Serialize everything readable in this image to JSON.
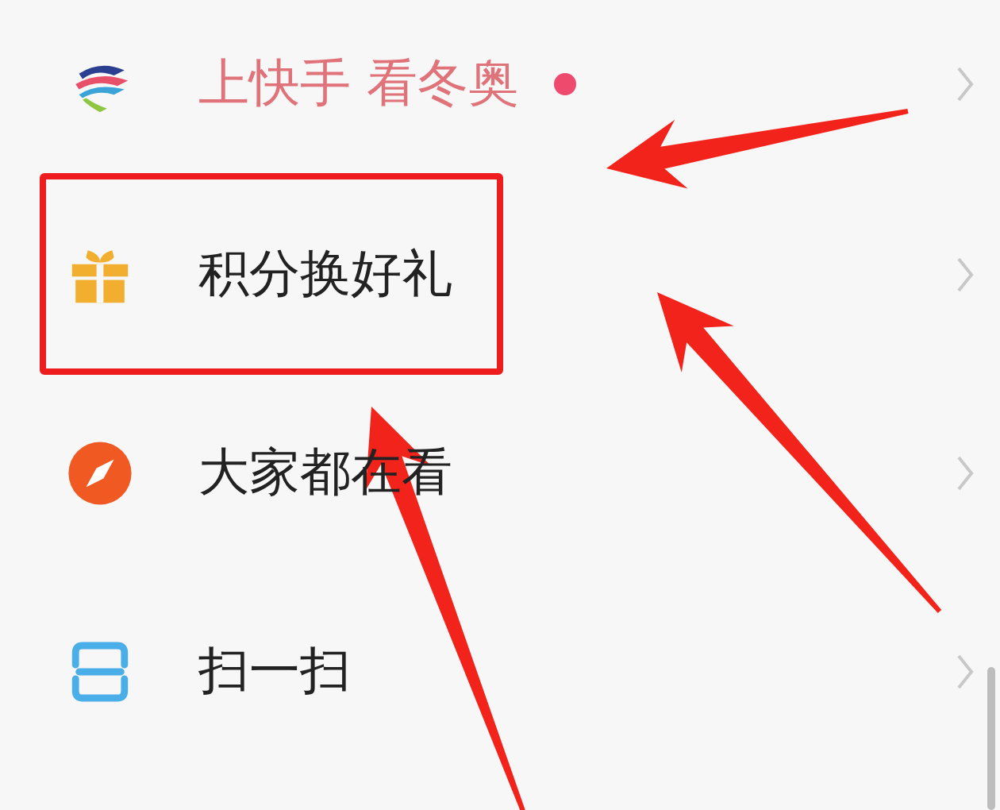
{
  "menu": {
    "items": [
      {
        "label": "上快手 看冬奥",
        "highlighted": true,
        "boxed": false
      },
      {
        "label": "积分换好礼",
        "highlighted": false,
        "boxed": true
      },
      {
        "label": "大家都在看",
        "highlighted": false,
        "boxed": false
      },
      {
        "label": "扫一扫",
        "highlighted": false,
        "boxed": false
      }
    ]
  }
}
